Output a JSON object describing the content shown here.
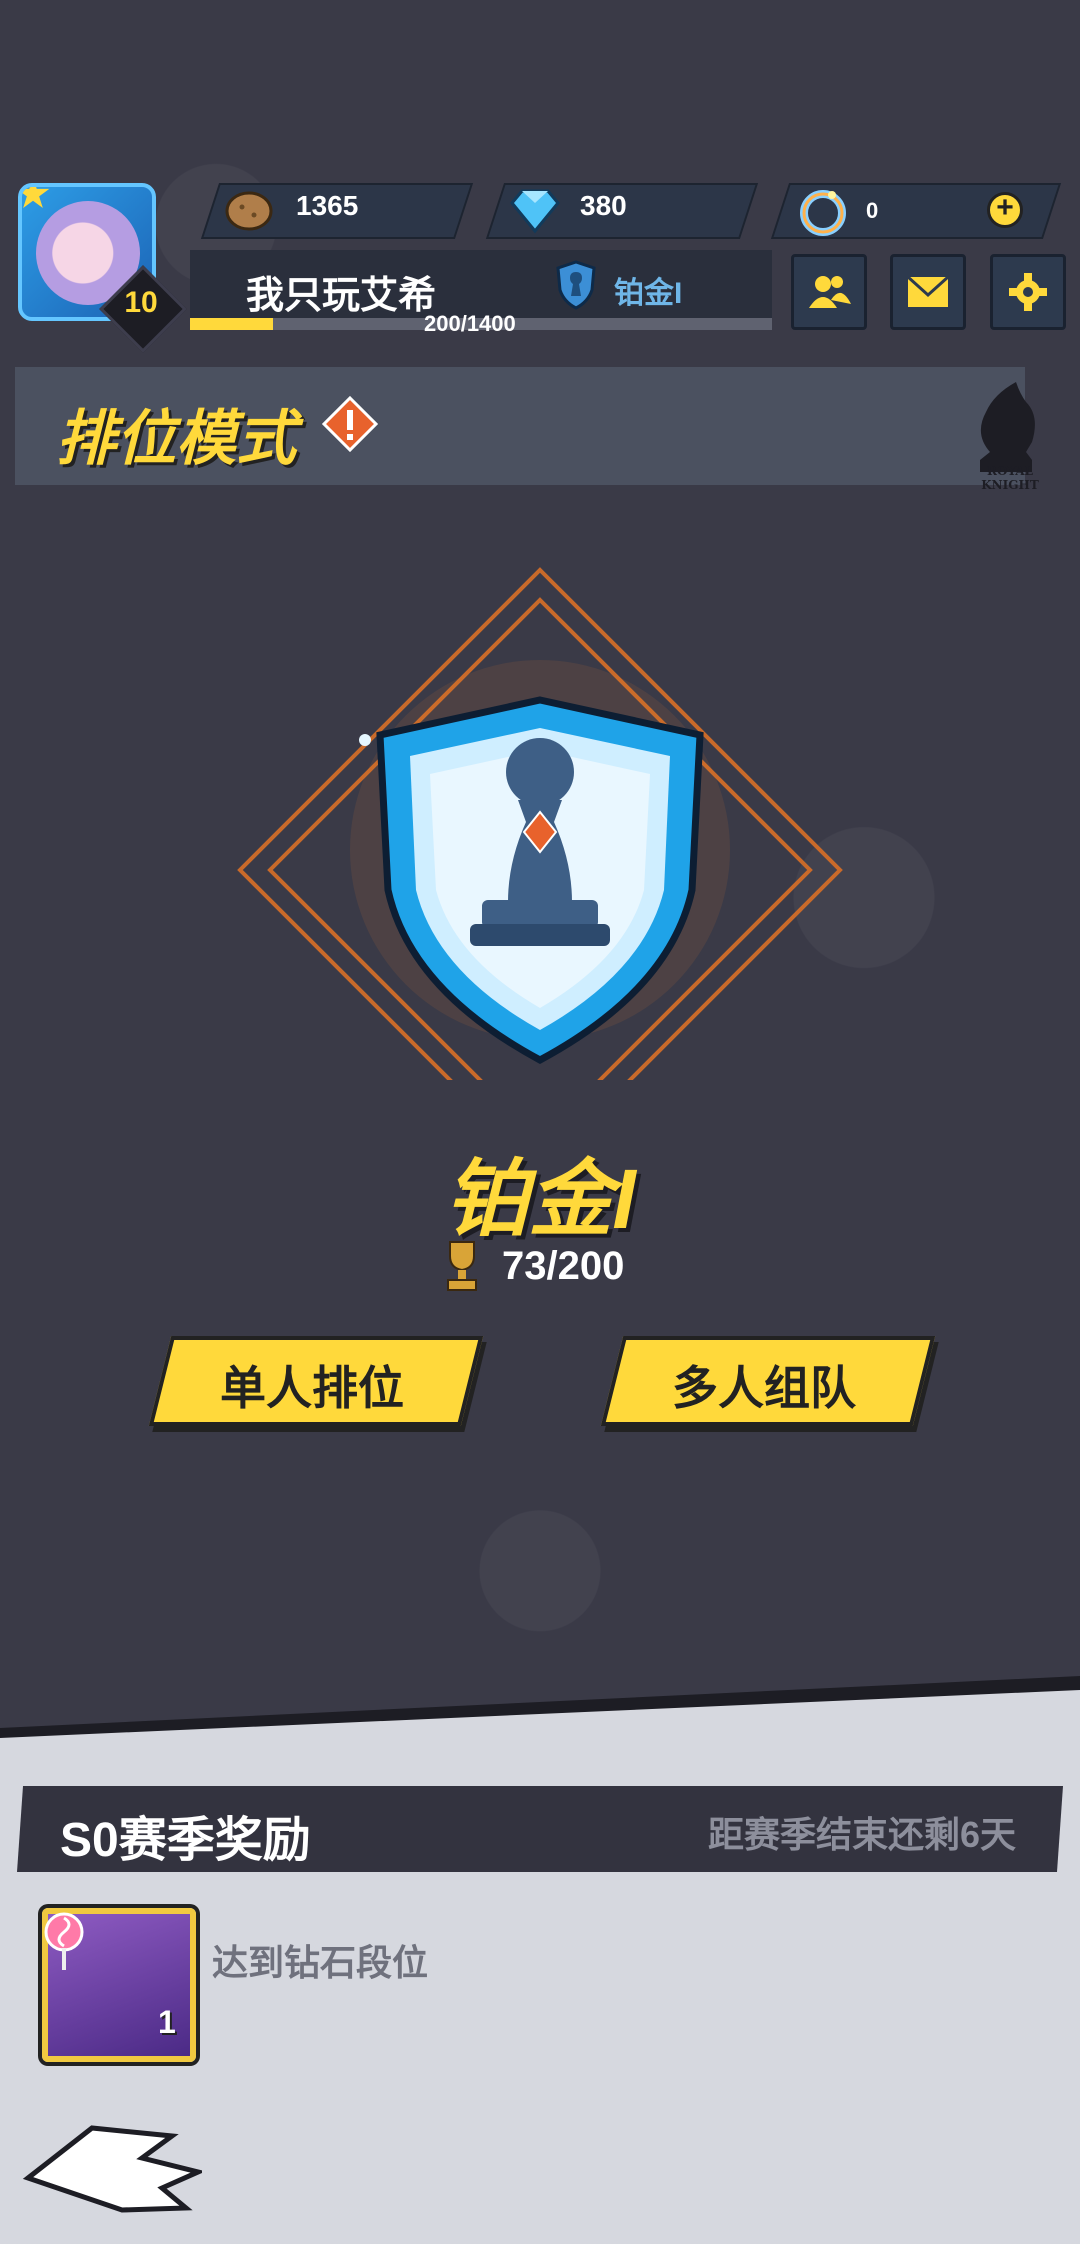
{
  "player": {
    "level": "10",
    "name": "我只玩艾希",
    "rank_label": "铂金I",
    "xp_text": "200/1400",
    "xp_fraction": 0.143
  },
  "resources": [
    {
      "name": "potato-currency",
      "value": "1365"
    },
    {
      "name": "diamond-currency",
      "value": "380"
    },
    {
      "name": "ring-currency",
      "value": "0"
    }
  ],
  "mode": {
    "title": "排位模式",
    "logo_text": "ROYAL KNIGHT"
  },
  "rank": {
    "name": "铂金I",
    "points": "73/200"
  },
  "buttons": {
    "solo": "单人排位",
    "team": "多人组队"
  },
  "season": {
    "title": "S0赛季奖励",
    "remaining": "距赛季结束还剩6天",
    "reward_desc": "达到钻石段位",
    "reward_count": "1"
  },
  "colors": {
    "accent": "#ffd93b",
    "background": "#3a3a47",
    "panel": "#d6d8df"
  }
}
